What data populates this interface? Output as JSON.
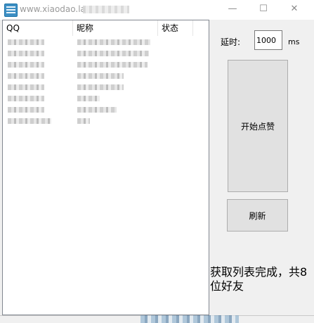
{
  "window": {
    "title": "www.xiaodao.la",
    "controls": {
      "minimize": "—",
      "maximize": "☐",
      "close": "✕"
    }
  },
  "list": {
    "columns": [
      "QQ",
      "昵称",
      "状态"
    ],
    "rows": [
      {
        "qq": "",
        "nickname": "",
        "status": ""
      },
      {
        "qq": "",
        "nickname": "",
        "status": ""
      },
      {
        "qq": "",
        "nickname": "",
        "status": ""
      },
      {
        "qq": "",
        "nickname": "",
        "status": ""
      },
      {
        "qq": "",
        "nickname": "",
        "status": ""
      },
      {
        "qq": "",
        "nickname": "",
        "status": ""
      },
      {
        "qq": "",
        "nickname": "",
        "status": ""
      },
      {
        "qq": "",
        "nickname": "",
        "status": ""
      }
    ]
  },
  "settings": {
    "delay_label": "延时:",
    "delay_value": "1000",
    "unit": "ms"
  },
  "buttons": {
    "start_like": "开始点赞",
    "refresh": "刷新"
  },
  "status_text": "获取列表完成，共8位好友",
  "colors": {
    "accent": "#3d8fc4",
    "button_bg": "#e1e1e1",
    "window_bg": "#f0f0f0"
  },
  "icons": {
    "app": "app-logo-icon"
  }
}
